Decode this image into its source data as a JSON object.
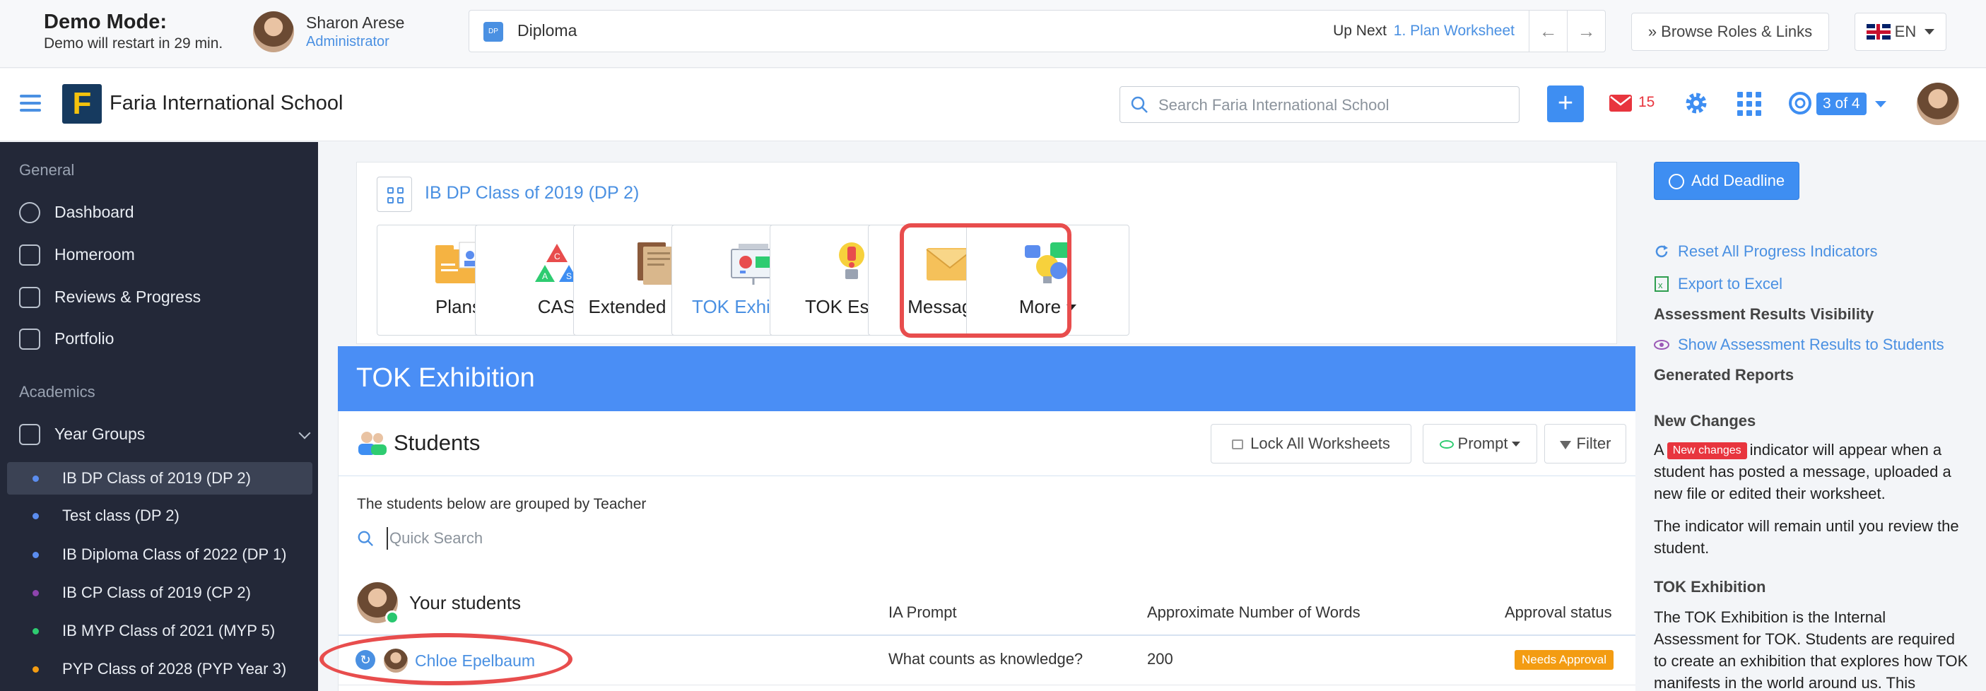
{
  "demo": {
    "title": "Demo Mode:",
    "subtitle": "Demo will restart in 29 min.",
    "user_name": "Sharon Arese",
    "user_role": "Administrator"
  },
  "programme": {
    "label": "Diploma",
    "icon_text": "DP",
    "up_next_label": "Up Next",
    "up_next_link": "1. Plan Worksheet",
    "prev_arrow": "←",
    "next_arrow": "→"
  },
  "browse": {
    "label": "» Browse Roles & Links"
  },
  "language": {
    "code": "EN"
  },
  "header": {
    "school_logo_letter": "F",
    "school_name": "Faria International School",
    "search_placeholder": "Search Faria International School",
    "plus_label": "+",
    "mail_count": "15",
    "count_badge": "3 of 4"
  },
  "sidebar": {
    "general_label": "General",
    "items": [
      {
        "label": "Dashboard",
        "icon": "dashboard-icon"
      },
      {
        "label": "Homeroom",
        "icon": "homeroom-icon"
      },
      {
        "label": "Reviews & Progress",
        "icon": "chart-line-icon"
      },
      {
        "label": "Portfolio",
        "icon": "briefcase-icon"
      }
    ],
    "academics_label": "Academics",
    "year_groups_label": "Year Groups",
    "classes": [
      {
        "label": "IB DP Class of 2019 (DP 2)",
        "dot": "#5b8def",
        "active": true
      },
      {
        "label": "Test class (DP 2)",
        "dot": "#5b8def",
        "active": false
      },
      {
        "label": "IB Diploma Class of 2022 (DP 1)",
        "dot": "#5b8def",
        "active": false
      },
      {
        "label": "IB CP Class of 2019 (CP 2)",
        "dot": "#8e44ad",
        "active": false
      },
      {
        "label": "IB MYP Class of 2021 (MYP 5)",
        "dot": "#2ecc71",
        "active": false
      },
      {
        "label": "PYP Class of 2028 (PYP Year 3)",
        "dot": "#f39c12",
        "active": false
      }
    ]
  },
  "class_card": {
    "title": "IB DP Class of 2019 (DP 2)",
    "tiles": [
      {
        "label": "Plans",
        "icon": "plans-folder-icon"
      },
      {
        "label": "CAS",
        "icon": "cas-triangle-icon"
      },
      {
        "label": "Extended Essay",
        "icon": "extended-essay-icon"
      },
      {
        "label": "TOK Exhibition",
        "icon": "tok-exhibition-icon"
      },
      {
        "label": "TOK Essay",
        "icon": "tok-essay-icon"
      },
      {
        "label": "Messages",
        "icon": "messages-envelope-icon"
      },
      {
        "label": "More",
        "icon": "more-ideas-icon"
      }
    ]
  },
  "tok": {
    "banner_title": "TOK Exhibition",
    "students_title": "Students",
    "lock_label": "Lock All Worksheets",
    "prompt_label": "Prompt",
    "filter_label": "Filter",
    "grouped_note": "The students below are grouped by Teacher",
    "quick_search_placeholder": "Quick Search",
    "group_title": "Your students",
    "columns": {
      "prompt": "IA Prompt",
      "words": "Approximate Number of Words",
      "approval": "Approval status"
    },
    "rows": [
      {
        "name": "Chloe Epelbaum",
        "prompt": "What counts as knowledge?",
        "words": "200",
        "approval": "Needs Approval"
      }
    ]
  },
  "right": {
    "add_deadline": "Add Deadline",
    "reset_link": "Reset All Progress Indicators",
    "export_link": "Export to Excel",
    "visibility_head": "Assessment Results Visibility",
    "show_results_link": "Show Assessment Results to Students",
    "reports_head": "Generated Reports",
    "new_changes_head": "New Changes",
    "nc_text_a": "A",
    "nc_badge": "New changes",
    "nc_text_b": "indicator will appear when a student has posted a message, uploaded a new file or edited their worksheet.",
    "nc_text_2": "The indicator will remain until you review the student.",
    "tok_head": "TOK Exhibition",
    "tok_text": "The TOK Exhibition is the Internal Assessment for TOK. Students are required to create an exhibition that explores how TOK manifests in the world around us. This"
  }
}
